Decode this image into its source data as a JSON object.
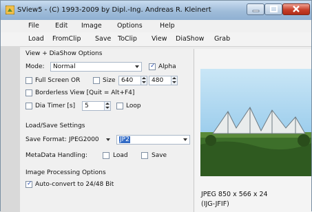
{
  "window": {
    "title": "SView5 - (C) 1993-2009 by Dipl.-Ing. Andreas R. Kleinert"
  },
  "menu": [
    "File",
    "Edit",
    "Image",
    "Options",
    "Help"
  ],
  "toolbar": [
    "Load",
    "FromClip",
    "Save",
    "ToClip",
    "View",
    "DiaShow",
    "Grab"
  ],
  "view_group": {
    "title": "View + DiaShow Options",
    "mode_label": "Mode:",
    "mode_value": "Normal",
    "alpha_label": "Alpha",
    "fullscreen_label": "Full Screen OR",
    "size_label": "Size",
    "size_w": "640",
    "size_h": "480",
    "borderless_label": "Borderless View [Quit = Alt+F4]",
    "dia_timer_label": "Dia Timer [s]",
    "dia_timer_value": "5",
    "loop_label": "Loop"
  },
  "load_save_group": {
    "title": "Load/Save Settings",
    "save_format_label": "Save Format:",
    "save_format_value": "JPEG2000",
    "save_ext_value": "JP2",
    "metadata_label": "MetaData Handling:",
    "meta_load_label": "Load",
    "meta_save_label": "Save"
  },
  "image_group": {
    "title": "Image Processing Options",
    "auto_convert_label": "Auto-convert to 24/48 Bit"
  },
  "preview_info": {
    "line1": "JPEG 850 x 566 x 24",
    "line2": "(IJG-JFIF)"
  }
}
